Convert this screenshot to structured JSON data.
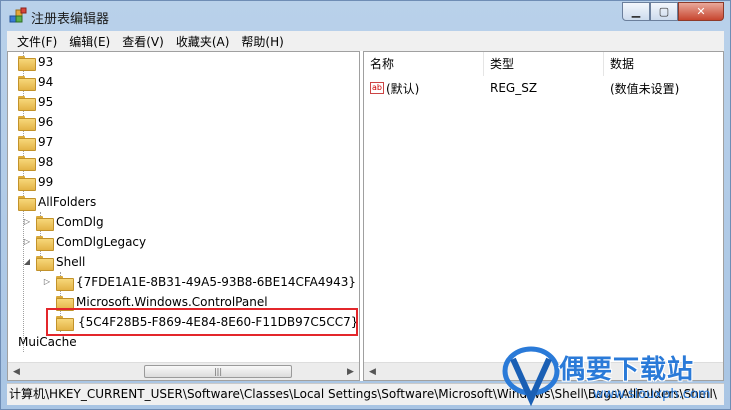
{
  "window": {
    "title": "注册表编辑器"
  },
  "menu": [
    "文件(F)",
    "编辑(E)",
    "查看(V)",
    "收藏夹(A)",
    "帮助(H)"
  ],
  "tree": {
    "items": [
      {
        "label": "93"
      },
      {
        "label": "94"
      },
      {
        "label": "95"
      },
      {
        "label": "96"
      },
      {
        "label": "97"
      },
      {
        "label": "98"
      },
      {
        "label": "99"
      },
      {
        "label": "AllFolders"
      },
      {
        "label": "ComDlg"
      },
      {
        "label": "ComDlgLegacy"
      },
      {
        "label": "Shell"
      },
      {
        "label": "{7FDE1A1E-8B31-49A5-93B8-6BE14CFA4943}"
      },
      {
        "label": "Microsoft.Windows.ControlPanel"
      },
      {
        "label": "{5C4F28B5-F869-4E84-8E60-F11DB97C5CC7}"
      },
      {
        "label": "MuiCache"
      }
    ]
  },
  "list": {
    "columns": [
      "名称",
      "类型",
      "数据"
    ],
    "rows": [
      {
        "name": "(默认)",
        "type": "REG_SZ",
        "data": "(数值未设置)"
      }
    ]
  },
  "status": {
    "path": "计算机\\HKEY_CURRENT_USER\\Software\\Classes\\Local Settings\\Software\\Microsoft\\Windows\\Shell\\Bags\\AllFolders\\Shell\\"
  },
  "watermark": {
    "text": "偶要下载站",
    "sub": "www.siouxph.com"
  },
  "colors": {
    "highlight_box": "#e3262b",
    "watermark": "#2a7ad8"
  }
}
